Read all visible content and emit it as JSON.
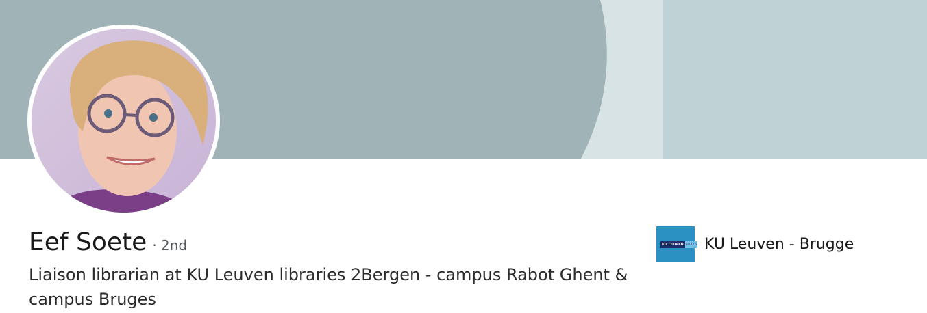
{
  "profile": {
    "name": "Eef Soete",
    "degree": "· 2nd",
    "headline": "Liaison librarian at KU Leuven libraries 2Bergen - campus Rabot Ghent & campus Bruges"
  },
  "company": {
    "name": "KU Leuven - Brugge",
    "logo_text": "KU LEUVEN",
    "logo_sub": "BRUGGE",
    "logo_color": "#2b91c2"
  },
  "banner": {
    "colors": [
      "#a0b3b6",
      "#d7e3e4",
      "#bfd2d5"
    ]
  },
  "icons": {
    "avatar": "profile-photo",
    "company_logo": "company-logo"
  }
}
